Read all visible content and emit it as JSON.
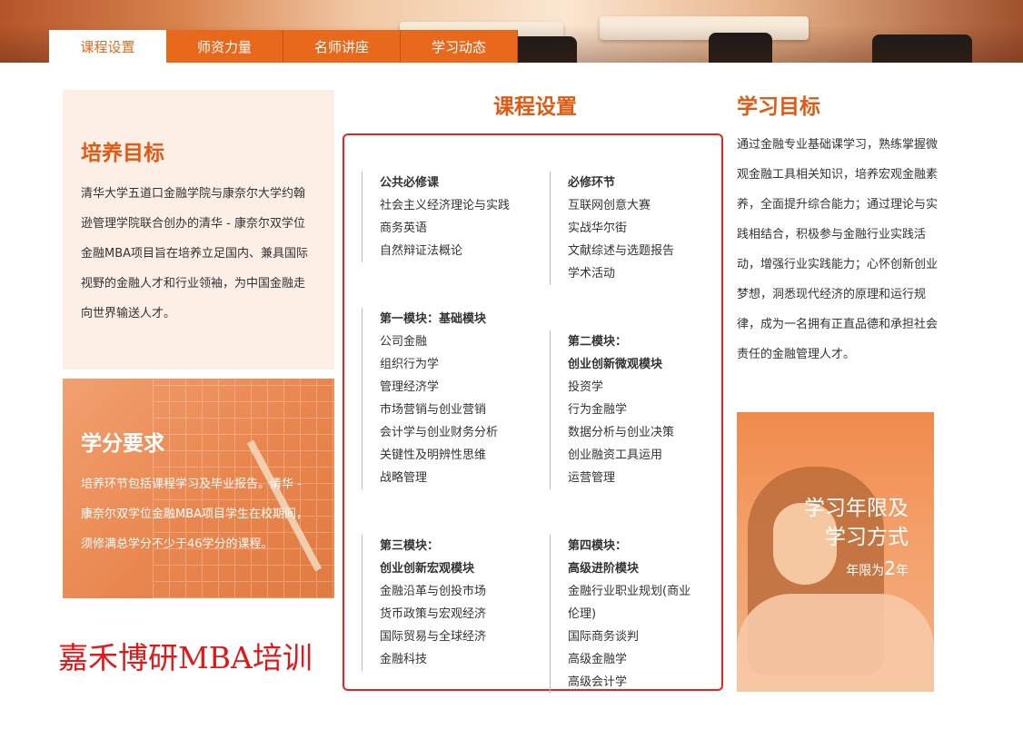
{
  "tabs": [
    {
      "label": "课程设置"
    },
    {
      "label": "师资力量"
    },
    {
      "label": "名师讲座"
    },
    {
      "label": "学习动态"
    }
  ],
  "train_goal": {
    "title": "培养目标",
    "text": "清华大学五道口金融学院与康奈尔大学约翰逊管理学院联合创办的清华 - 康奈尔双学位金融MBA项目旨在培养立足国内、兼具国际视野的金融人才和行业领袖，为中国金融走向世界输送人才。"
  },
  "credit": {
    "title": "学分要求",
    "text": "培养环节包括课程学习及毕业报告。清华 - 康奈尔双学位金融MBA项目学生在校期间，须修满总学分不少于46学分的课程。"
  },
  "watermark": "嘉禾博研MBA培训",
  "courses": {
    "title": "课程设置",
    "public_required": {
      "head": "公共必修课",
      "items": [
        "社会主义经济理论与实践",
        "商务英语",
        "自然辩证法概论"
      ]
    },
    "required_link": {
      "head": "必修环节",
      "items": [
        "互联网创意大赛",
        "实战华尔街",
        "文献综述与选题报告",
        "学术活动"
      ]
    },
    "module1": {
      "head": "第一模块：基础模块",
      "items": [
        "公司金融",
        "组织行为学",
        "管理经济学",
        "市场营销与创业营销",
        "会计学与创业财务分析",
        "关键性及明辨性思维",
        "战略管理"
      ]
    },
    "module2": {
      "head1": "第二模块：",
      "head2": "创业创新微观模块",
      "items": [
        "投资学",
        "行为金融学",
        "数据分析与创业决策",
        "创业融资工具运用",
        "运营管理"
      ]
    },
    "module3": {
      "head1": "第三模块：",
      "head2": "创业创新宏观模块",
      "items": [
        "金融沿革与创投市场",
        "货币政策与宏观经济",
        "国际贸易与全球经济",
        "金融科技"
      ]
    },
    "module4": {
      "head1": "第四模块：",
      "head2": "高级进阶模块",
      "items": [
        "金融行业职业规划(商业",
        "伦理)",
        "国际商务谈判",
        "高级金融学",
        "高级会计学"
      ]
    }
  },
  "study_goal": {
    "title": "学习目标",
    "text": "通过金融专业基础课学习，熟练掌握微观金融工具相关知识，培养宏观金融素养，全面提升综合能力；通过理论与实践相结合，积极参与金融行业实践活动，增强行业实践能力；心怀创新创业梦想，洞悉现代经济的原理和运行规律，成为一名拥有正直品德和承担社会责任的金融管理人才。"
  },
  "promo": {
    "line1": "学习年限及",
    "line2": "学习方式",
    "years_prefix": "年限为",
    "years_value": "2",
    "years_unit": "年"
  },
  "colors": {
    "accent": "#e8681c",
    "title": "#e05a14",
    "box_border": "#ee2020",
    "watermark": "#e01818"
  }
}
